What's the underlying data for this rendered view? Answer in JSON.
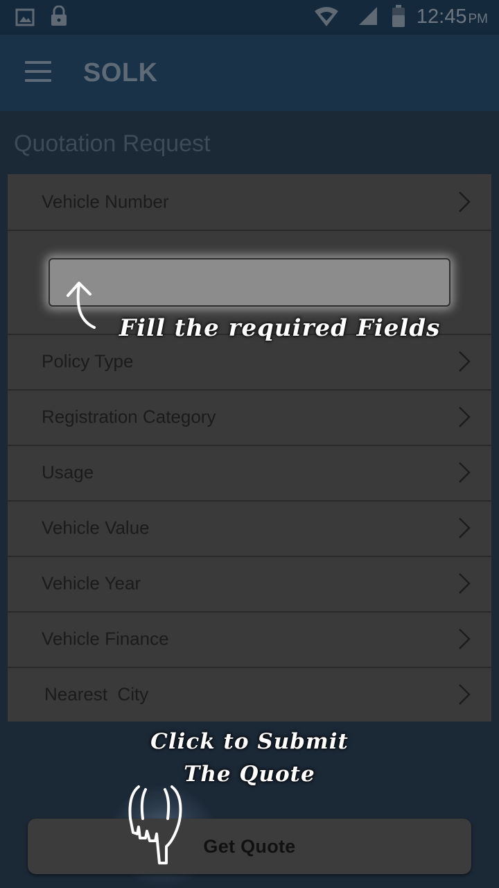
{
  "status_bar": {
    "icons": [
      "image-icon",
      "lock-icon",
      "wifi-icon",
      "signal-icon",
      "battery-icon"
    ],
    "time": "12:45",
    "ampm": "PM"
  },
  "app_bar": {
    "menu_icon": "hamburger-menu-icon",
    "title": "SOLK"
  },
  "page": {
    "heading": "Quotation Request"
  },
  "form": {
    "vehicle_number": "Vehicle Number",
    "vehicle_number_value": "",
    "items": [
      {
        "label": "Policy Type"
      },
      {
        "label": "Registration Category"
      },
      {
        "label": "Usage"
      },
      {
        "label": "Vehicle Value"
      },
      {
        "label": "Vehicle Year"
      },
      {
        "label": "Vehicle Finance"
      },
      {
        "label": "Nearest  City"
      }
    ]
  },
  "hints": {
    "fill_fields": "Fill the required Fields",
    "submit_line1": "Click to Submit",
    "submit_line2": "The Quote"
  },
  "button": {
    "label": "Get Quote"
  },
  "colors": {
    "overlay_dark": "#16202b",
    "card": "#3a3a3a",
    "hint_text": "#ffffff"
  }
}
